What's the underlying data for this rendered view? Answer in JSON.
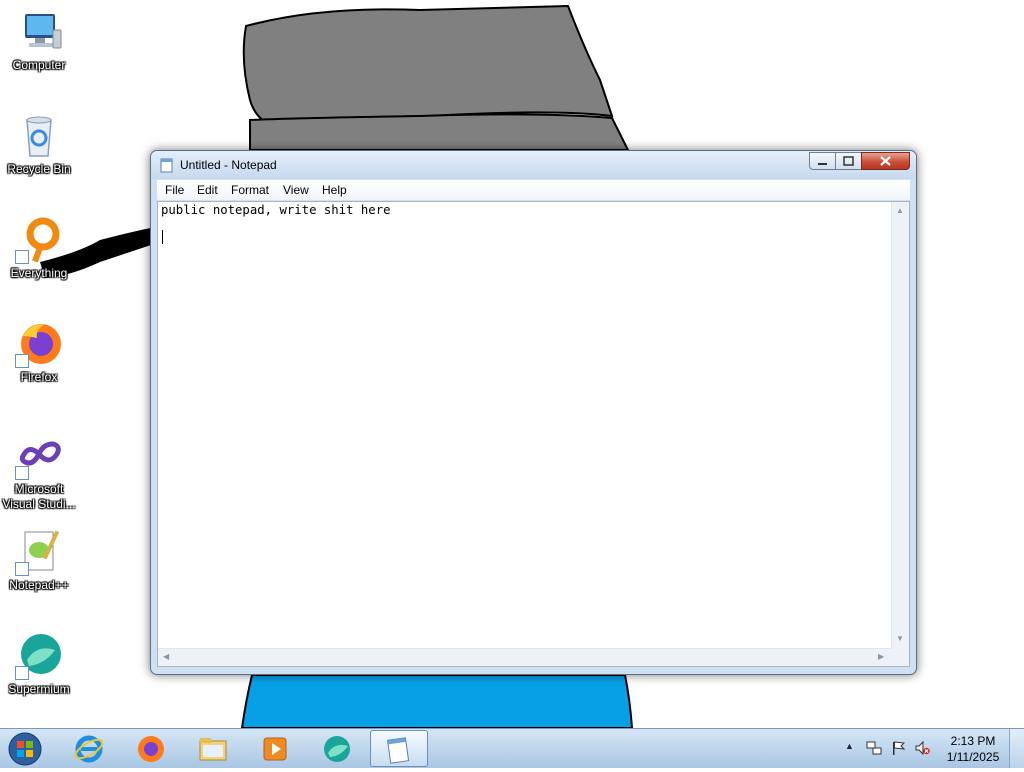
{
  "desktop": {
    "icons": [
      {
        "label": "Computer",
        "icon": "computer-icon"
      },
      {
        "label": "Recycle Bin",
        "icon": "recycle-bin-icon"
      },
      {
        "label": "Everything",
        "icon": "everything-search-icon"
      },
      {
        "label": "Firefox",
        "icon": "firefox-icon"
      },
      {
        "label_line1": "Microsoft",
        "label_line2": "Visual Studi...",
        "icon": "visual-studio-icon"
      },
      {
        "label": "Notepad++",
        "icon": "notepad-plus-plus-icon"
      },
      {
        "label": "Supermium",
        "icon": "supermium-icon"
      }
    ]
  },
  "notepad": {
    "title": "Untitled - Notepad",
    "menu": [
      "File",
      "Edit",
      "Format",
      "View",
      "Help"
    ],
    "content": "public notepad, write shit here"
  },
  "taskbar": {
    "pinned": [
      "internet-explorer-icon",
      "firefox-icon",
      "file-explorer-icon",
      "media-player-icon",
      "supermium-icon",
      "notepad-icon"
    ],
    "tray_icons": [
      "show-hidden-icons",
      "network-icon",
      "action-center-flag-icon",
      "volume-muted-icon"
    ],
    "clock": {
      "time": "2:13 PM",
      "date": "1/11/2025"
    }
  },
  "colors": {
    "wallpaper_gray": "#808080",
    "wallpaper_blue": "#06a0e6",
    "wallpaper_black": "#000000",
    "close_button_red": "#c94f3c",
    "taskbar": "#bcd4ec"
  }
}
